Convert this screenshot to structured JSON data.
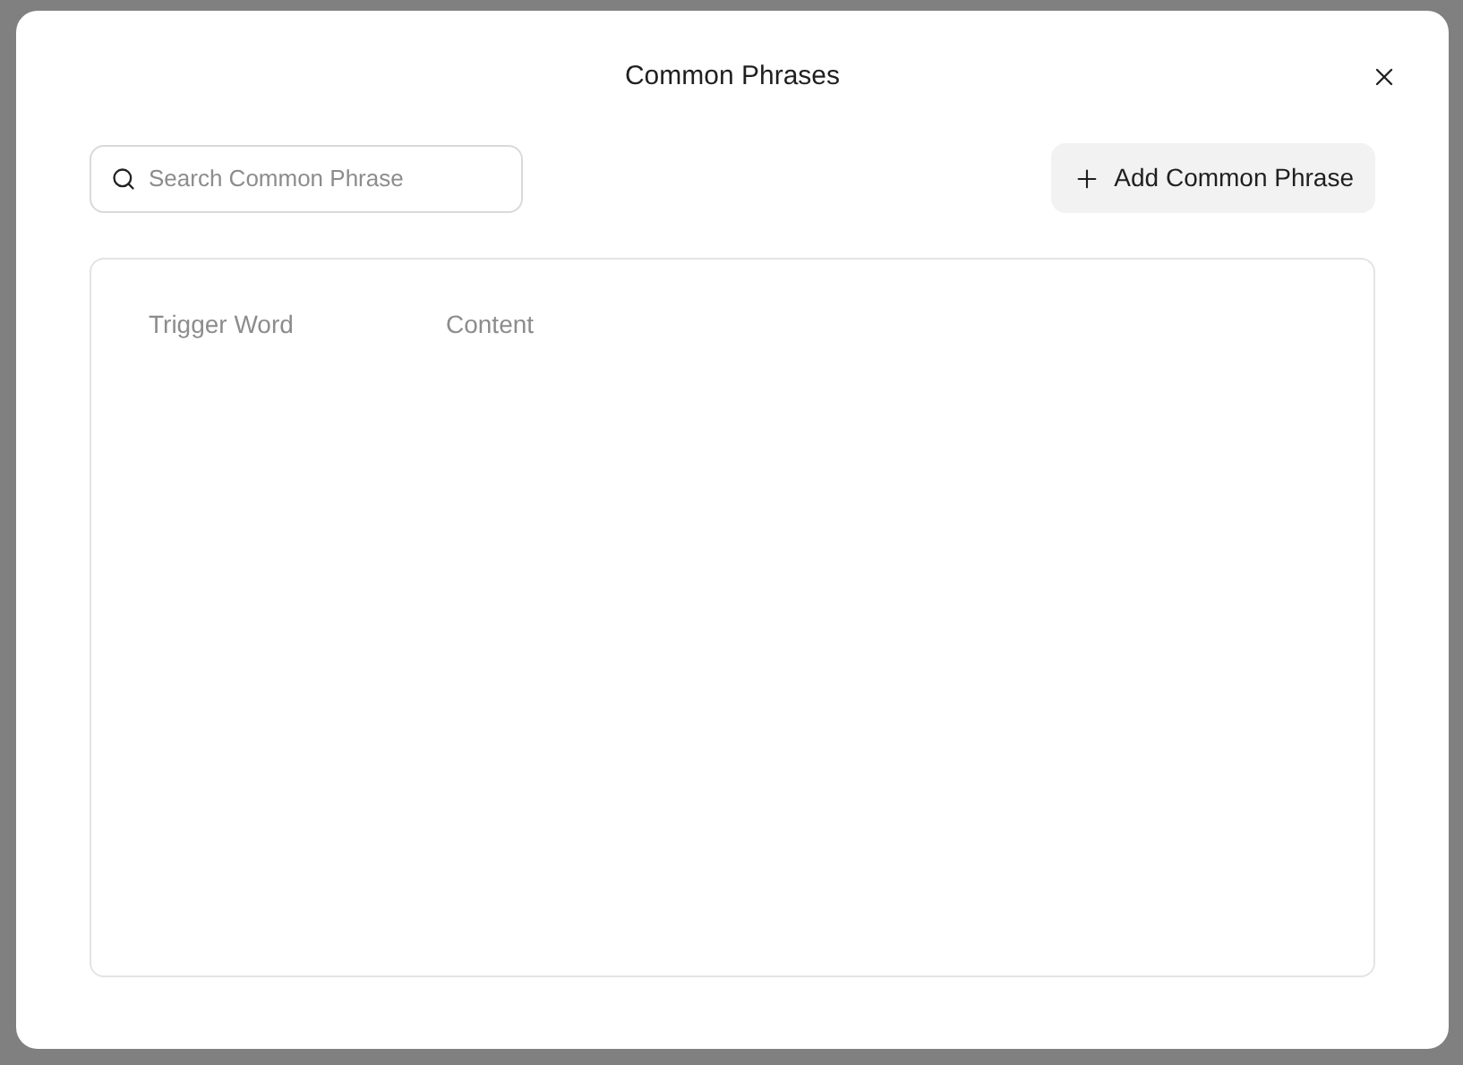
{
  "dialog": {
    "title": "Common Phrases",
    "search": {
      "placeholder": "Search Common Phrase"
    },
    "add_button": {
      "label": "Add Common Phrase"
    },
    "table": {
      "columns": [
        "Trigger Word",
        "Content"
      ]
    }
  }
}
